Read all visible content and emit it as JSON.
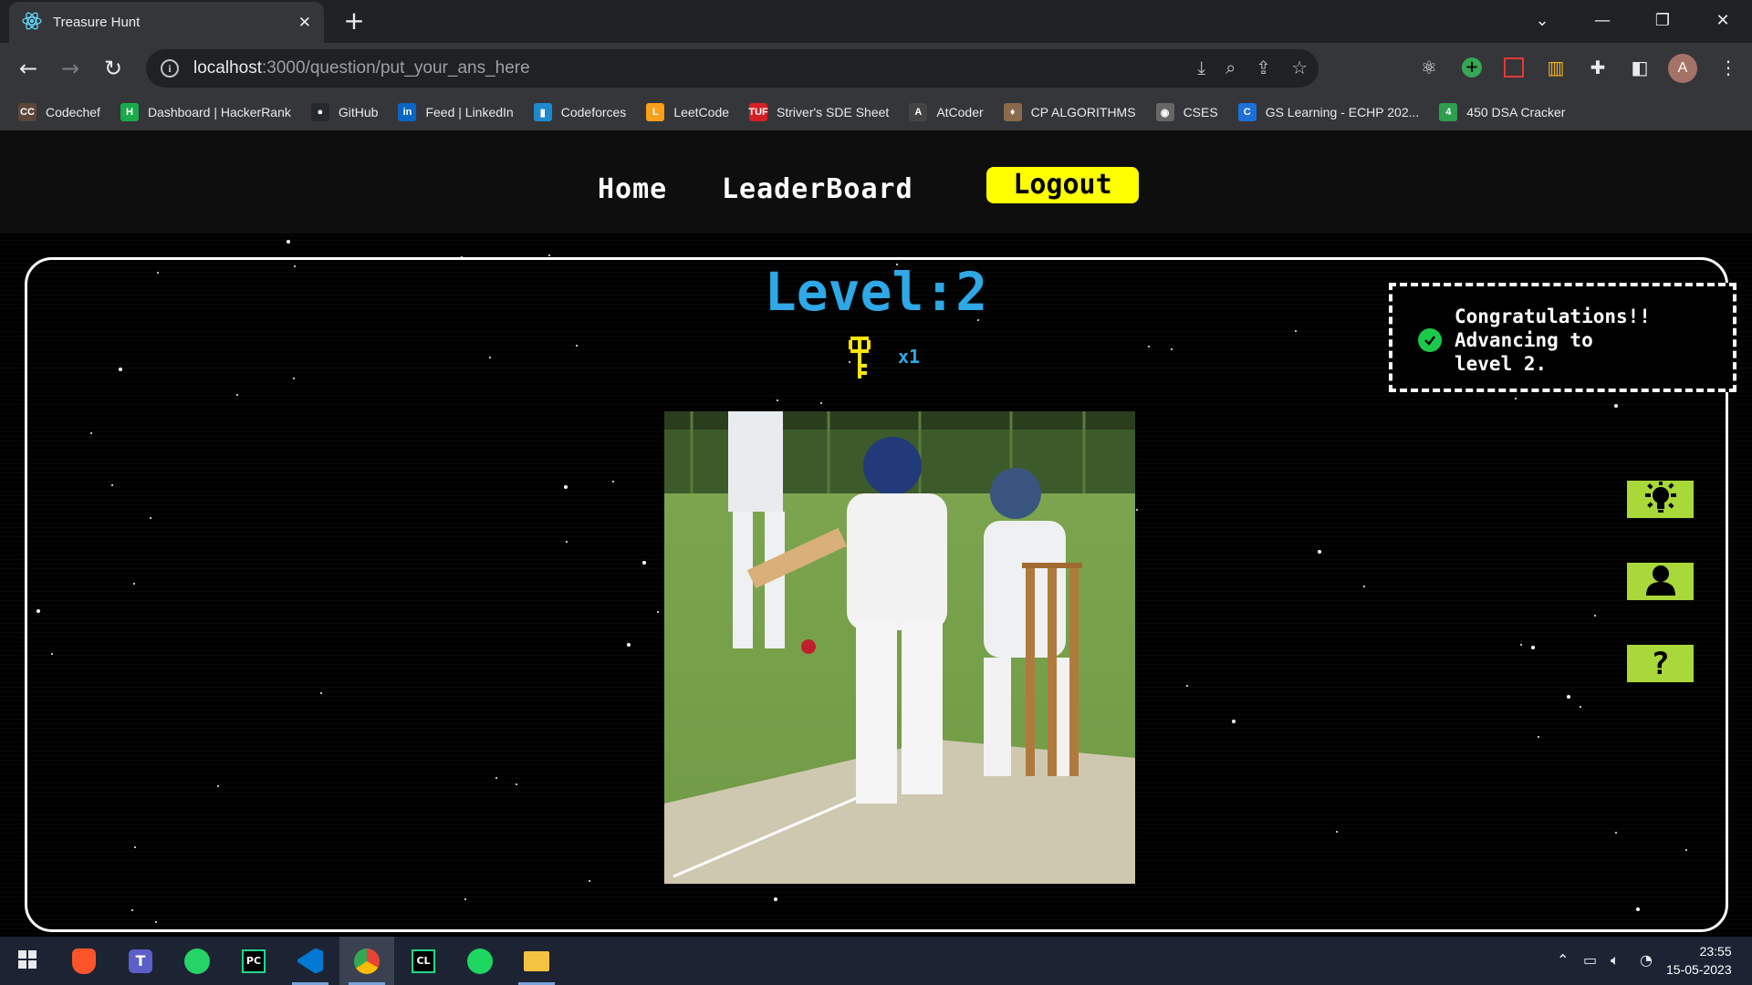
{
  "browser": {
    "tab_title": "Treasure Hunt",
    "tab_close": "✕",
    "new_tab": "+",
    "url_host": "localhost",
    "url_path": ":3000/question/put_your_ans_here",
    "profile_initial": "A"
  },
  "bookmarks": [
    {
      "label": "Codechef",
      "icon": "codechef-icon",
      "glyph": "CC",
      "color": "#5b4638"
    },
    {
      "label": "Dashboard | HackerRank",
      "icon": "hackerrank-icon",
      "glyph": "H",
      "color": "#1ba94c"
    },
    {
      "label": "GitHub",
      "icon": "github-icon",
      "glyph": "●",
      "color": "#24292e"
    },
    {
      "label": "Feed | LinkedIn",
      "icon": "linkedin-icon",
      "glyph": "in",
      "color": "#0a66c2"
    },
    {
      "label": "Codeforces",
      "icon": "codeforces-icon",
      "glyph": "▮",
      "color": "#1f8acb"
    },
    {
      "label": "LeetCode",
      "icon": "leetcode-icon",
      "glyph": "L",
      "color": "#f89f1b"
    },
    {
      "label": "Striver's SDE Sheet",
      "icon": "tuf-icon",
      "glyph": "TUF",
      "color": "#d41f26"
    },
    {
      "label": "AtCoder",
      "icon": "atcoder-icon",
      "glyph": "A",
      "color": "#444"
    },
    {
      "label": "CP ALGORITHMS",
      "icon": "cp-algorithms-icon",
      "glyph": "♦",
      "color": "#8a6a4a"
    },
    {
      "label": "CSES",
      "icon": "cses-icon",
      "glyph": "◉",
      "color": "#666"
    },
    {
      "label": "GS Learning - ECHP 202...",
      "icon": "gs-learning-icon",
      "glyph": "C",
      "color": "#1e6fd9"
    },
    {
      "label": "450 DSA Cracker",
      "icon": "dsa-cracker-icon",
      "glyph": "4",
      "color": "#2e9e4f"
    }
  ],
  "nav": {
    "home": "Home",
    "leaderboard": "LeaderBoard",
    "logout": "Logout"
  },
  "game": {
    "level_label": "Level:2",
    "key_count": "x1"
  },
  "toast": {
    "message": "Congratulations!!\nAdvancing to\nlevel 2."
  },
  "side_buttons": [
    {
      "icon": "hint-lightbulb-icon"
    },
    {
      "icon": "user-icon"
    },
    {
      "icon": "help-question-icon",
      "glyph": "?"
    }
  ],
  "taskbar": {
    "time": "23:55",
    "date": "15-05-2023"
  },
  "colors": {
    "accent_blue": "#2ea8e6",
    "logout_yellow": "#ffff00",
    "side_button_green": "#a8d83a",
    "toast_check_green": "#1bc94a"
  }
}
